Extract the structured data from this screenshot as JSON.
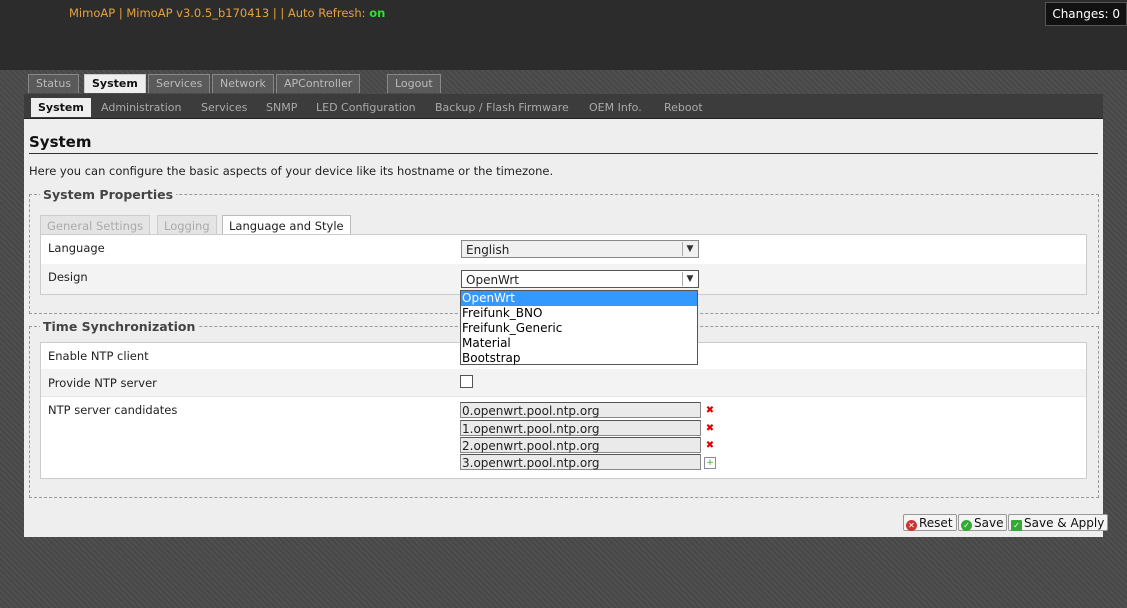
{
  "header": {
    "title_prefix": "MimoAP | MimoAP v3.0.5_b170413 | | Auto Refresh: ",
    "auto_refresh_state": "on",
    "changes_label": "Changes: 0"
  },
  "main_tabs": [
    "Status",
    "System",
    "Services",
    "Network",
    "APController",
    "Logout"
  ],
  "sub_tabs": [
    "System",
    "Administration",
    "Services",
    "SNMP",
    "LED Configuration",
    "Backup / Flash Firmware",
    "OEM Info.",
    "Reboot"
  ],
  "page": {
    "title": "System",
    "description": "Here you can configure the basic aspects of your device like its hostname or the timezone."
  },
  "system_properties": {
    "legend": "System Properties",
    "tabs": [
      "General Settings",
      "Logging",
      "Language and Style"
    ],
    "language_label": "Language",
    "language_value": "English",
    "design_label": "Design",
    "design_value": "OpenWrt",
    "design_options": [
      "OpenWrt",
      "Freifunk_BNO",
      "Freifunk_Generic",
      "Material",
      "Bootstrap"
    ]
  },
  "time_sync": {
    "legend": "Time Synchronization",
    "enable_ntp_label": "Enable NTP client",
    "provide_ntp_label": "Provide NTP server",
    "candidates_label": "NTP server candidates",
    "candidates": [
      "0.openwrt.pool.ntp.org",
      "1.openwrt.pool.ntp.org",
      "2.openwrt.pool.ntp.org",
      "3.openwrt.pool.ntp.org"
    ]
  },
  "actions": {
    "reset": "Reset",
    "save": "Save",
    "save_apply": "Save & Apply"
  }
}
